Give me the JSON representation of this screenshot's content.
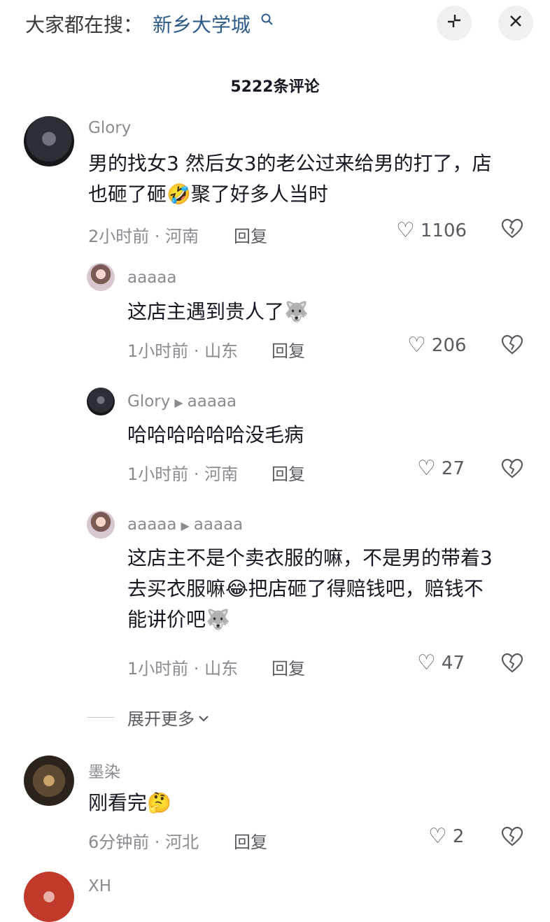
{
  "header": {
    "hot_label": "大家都在搜：",
    "hot_query": "新乡大学城",
    "search_icon": "search-icon",
    "collapse_icon": "collapse-icon",
    "close_icon": "close-icon",
    "comment_count": "5222条评论"
  },
  "comments": [
    {
      "name": "Glory",
      "text1": "男的找女3 然后女3的老公过来给男的打了，店",
      "text2a": "也砸了砸",
      "emoji": "🤣",
      "text2b": "聚了好多人当时",
      "time": "2小时前 · 河南",
      "reply": "回复",
      "likes": "1106"
    },
    {
      "name": "aaaaa",
      "text": "这店主遇到贵人了",
      "emoji": "🐺",
      "time": "1小时前 · 山东",
      "reply": "回复",
      "likes": "206"
    },
    {
      "name": "Glory",
      "reply_to": "aaaaa",
      "text": "哈哈哈哈哈哈没毛病",
      "time": "1小时前 · 河南",
      "reply": "回复",
      "likes": "27"
    },
    {
      "name": "aaaaa",
      "reply_to": "aaaaa",
      "text1": "这店主不是个卖衣服的嘛，不是男的带着3",
      "text2a": "去买衣服嘛",
      "emoji": "😂",
      "text2b": "把店砸了得赔钱吧，赔钱不",
      "text3": "能讲价吧",
      "emoji2": "🐺",
      "time": "1小时前 · 山东",
      "reply": "回复",
      "likes": "47"
    },
    {
      "name": "墨染",
      "text": "刚看完",
      "emoji": "🤔",
      "time": "6分钟前 · 河北",
      "reply": "回复",
      "likes": "2"
    },
    {
      "name": "XH"
    }
  ],
  "expand_label": "展开更多",
  "icons": {
    "like": "heart-outline-icon",
    "dislike": "broken-heart-icon",
    "arrow": "play-arrow-icon",
    "chevron": "chevron-down-icon"
  }
}
